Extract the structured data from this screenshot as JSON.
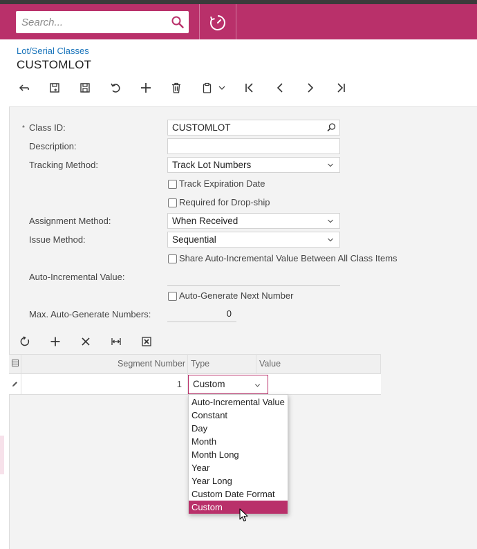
{
  "header": {
    "search_placeholder": "Search...",
    "icons": [
      "search-icon",
      "history-clock-icon"
    ]
  },
  "page": {
    "breadcrumb": "Lot/Serial Classes",
    "title": "CUSTOMLOT"
  },
  "toolbar": {
    "items": [
      "back-icon",
      "save-and-close-icon",
      "save-icon",
      "cancel-icon",
      "add-icon",
      "delete-icon",
      "clipboard-icon",
      "first-icon",
      "previous-icon",
      "next-icon",
      "last-icon"
    ]
  },
  "form": {
    "required_mark": "*",
    "class_id_label": "Class ID:",
    "class_id_value": "CUSTOMLOT",
    "description_label": "Description:",
    "description_value": "",
    "tracking_method_label": "Tracking Method:",
    "tracking_method_value": "Track Lot Numbers",
    "track_expiration_label": "Track Expiration Date",
    "required_dropship_label": "Required for Drop-ship",
    "assignment_method_label": "Assignment Method:",
    "assignment_method_value": "When Received",
    "issue_method_label": "Issue Method:",
    "issue_method_value": "Sequential",
    "share_auto_label": "Share Auto-Incremental Value Between All Class Items",
    "auto_incremental_label": "Auto-Incremental Value:",
    "auto_incremental_value": "",
    "auto_generate_label": "Auto-Generate Next Number",
    "max_auto_label": "Max. Auto-Generate Numbers:",
    "max_auto_value": "0"
  },
  "grid": {
    "toolbar": [
      "refresh-icon",
      "add-row-icon",
      "delete-row-icon",
      "fit-columns-icon",
      "export-excel-icon"
    ],
    "columns": [
      "Segment Number",
      "Type",
      "Value"
    ],
    "rows": [
      {
        "segment_number": "1",
        "type": "Custom",
        "value": ""
      }
    ]
  },
  "dropdown": {
    "options": [
      "Auto-Incremental Value",
      "Constant",
      "Day",
      "Month",
      "Month Long",
      "Year",
      "Year Long",
      "Custom Date Format",
      "Custom"
    ],
    "selected": "Custom"
  },
  "colors": {
    "accent": "#b9306a",
    "link": "#1b75bb",
    "form_bg": "#f3f3f3"
  }
}
